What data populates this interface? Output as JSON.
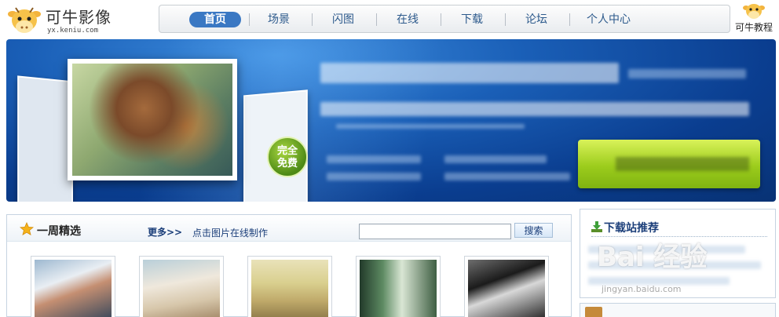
{
  "header": {
    "logo_title": "可牛影像",
    "logo_url": "yx.keniu.com",
    "tutorial_label": "可牛教程"
  },
  "nav": {
    "items": [
      {
        "label": "首页",
        "active": true
      },
      {
        "label": "场景",
        "active": false
      },
      {
        "label": "闪图",
        "active": false
      },
      {
        "label": "在线",
        "active": false
      },
      {
        "label": "下载",
        "active": false
      },
      {
        "label": "论坛",
        "active": false
      },
      {
        "label": "个人中心",
        "active": false
      }
    ]
  },
  "banner": {
    "badge_line1": "完全",
    "badge_line2": "免费"
  },
  "weekly": {
    "title": "一周精选",
    "more_label": "更多>>",
    "hint": "点击图片在线制作",
    "search_value": "",
    "search_button": "搜索",
    "thumbnails": [
      "thumb-1",
      "thumb-2",
      "thumb-3",
      "thumb-4",
      "thumb-5"
    ]
  },
  "download_rec": {
    "title": "下载站推荐"
  },
  "watermark": {
    "main": "Bai 经验",
    "sub": "jingyan.baidu.com"
  },
  "colors": {
    "nav_active": "#3a78c3",
    "link": "#1c3f7a",
    "banner": "#1a5fb7",
    "download_button": "#9ccc1c"
  }
}
